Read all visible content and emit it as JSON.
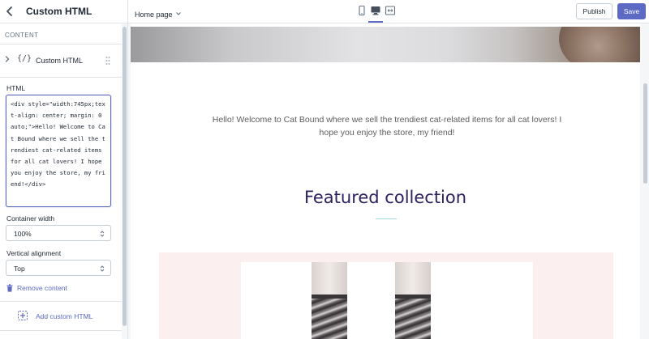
{
  "sidebar": {
    "title": "Custom HTML",
    "section_label": "CONTENT",
    "block": {
      "icon": "{/}",
      "label": "Custom HTML"
    },
    "html_label": "HTML",
    "html_value": "<div style=\"width:745px;text-align: center; margin: 0 auto;\">Hello! Welcome to Cat Bound where we sell the trendiest cat-related items for all cat lovers! I hope you enjoy the store, my friend!</div>",
    "container_width": {
      "label": "Container width",
      "value": "100%"
    },
    "vertical_alignment": {
      "label": "Vertical alignment",
      "value": "Top"
    },
    "remove_label": "Remove content",
    "add_label": "Add custom HTML"
  },
  "topbar": {
    "page_selector": "Home page",
    "devices": [
      "mobile-icon",
      "desktop-icon",
      "fullscreen-icon"
    ],
    "active_device": "desktop",
    "publish_label": "Publish",
    "save_label": "Save"
  },
  "preview": {
    "welcome_text": "Hello! Welcome to Cat Bound where we sell the trendiest cat-related items for all cat lovers! I hope you enjoy the store, my friend!",
    "featured_heading": "Featured collection"
  },
  "colors": {
    "accent": "#5c6ac4",
    "heading": "#2d1f5e",
    "divider_accent": "#9fd9e4",
    "product_bg": "#fcefef"
  }
}
